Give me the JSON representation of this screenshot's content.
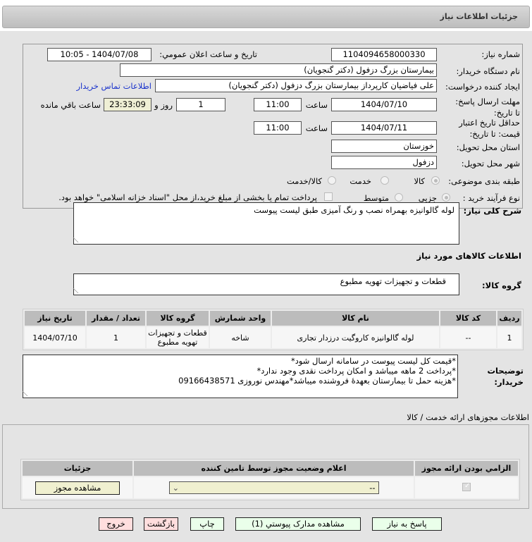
{
  "header": {
    "title": "جزئیات اطلاعات نیاز"
  },
  "form": {
    "need_number_label": "شماره نیاز:",
    "need_number": "1104094658000330",
    "announce_label": "تاریخ و ساعت اعلان عمومي:",
    "announce_value": "1404/07/08 - 10:05",
    "buyer_org_label": "نام دستگاه خريدار:",
    "buyer_org": "بیمارستان بزرگ دزفول (دکتر گنجویان)",
    "creator_label": "ايجاد کننده درخواست:",
    "creator": "علی فیاضیان کارپرداز بیمارستان بزرگ دزفول (دکتر گنجویان)",
    "contact_link": "اطلاعات تماس خریدار",
    "deadline_label": "مهلت ارسال پاسخ: تا تاریخ:",
    "deadline_date": "1404/07/10",
    "time_label": "ساعت",
    "deadline_time": "11:00",
    "days": "1",
    "days_label": "روز و",
    "countdown": "23:33:09",
    "remaining_label": "ساعت باقي مانده",
    "validity_label": "حداقل تاریخ اعتبار قیمت: تا تاریخ:",
    "validity_date": "1404/07/11",
    "validity_time": "11:00",
    "province_label": "استان محل تحویل:",
    "province": "خوزستان",
    "city_label": "شهر محل تحویل:",
    "city": "دزفول",
    "category_label": "طبقه بندی موضوعی:",
    "category_options": [
      "کالا",
      "خدمت",
      "کالا/خدمت"
    ],
    "process_label": "نوع فرآیند خرید :",
    "process_options": [
      "جزیی",
      "متوسط"
    ],
    "treasury_note": "پرداخت تمام یا بخشی از مبلغ خرید،از محل \"اسناد خزانه اسلامی\" خواهد بود.",
    "description_label": "شرح کلی نیاز:",
    "description": "لوله گالوانیزه بهمراه نصب و رنگ آمیزی طبق لیست پیوست"
  },
  "goods": {
    "section_title": "اطلاعات کالاهای مورد نیاز",
    "group_label": "گروه کالا:",
    "group": "قطعات و تجهیزات تهویه مطبوع",
    "columns": [
      "ردیف",
      "کد کالا",
      "نام کالا",
      "واحد شمارش",
      "گروه کالا",
      "تعداد / مقدار",
      "تاریخ نیاز"
    ],
    "rows": [
      [
        "1",
        "--",
        "لوله گالوانیزه کاروگیت درزدار تجاری",
        "شاخه",
        "قطعات و تجهیزات تهویه مطبوع",
        "1",
        "1404/07/10"
      ]
    ]
  },
  "notes": {
    "label": "توضیحات خریدار:",
    "lines": [
      "*قیمت کل لیست پیوست در سامانه ارسال شود*",
      "*پرداخت 2 ماهه میباشد و امکان پرداخت نقدی وجود ندارد*",
      "*هزینه حمل تا بیمارستان بعهدهٔ فروشنده میباشد*مهندس نوروزی  09166438571"
    ]
  },
  "permits": {
    "title": "اطلاعات مجوزهای ارائه خدمت / کالا",
    "columns": [
      "الزامي بودن ارائه مجوز",
      "اعلام وضعیت مجوز توسط تامین کننده",
      "جزئیات"
    ],
    "select_value": "--",
    "view_button": "مشاهده مجوز"
  },
  "buttons": {
    "reply": "پاسخ به نیاز",
    "attachments": "مشاهده مدارک پیوستي (1)",
    "print": "چاپ",
    "back": "بازگشت",
    "exit": "خروج"
  }
}
